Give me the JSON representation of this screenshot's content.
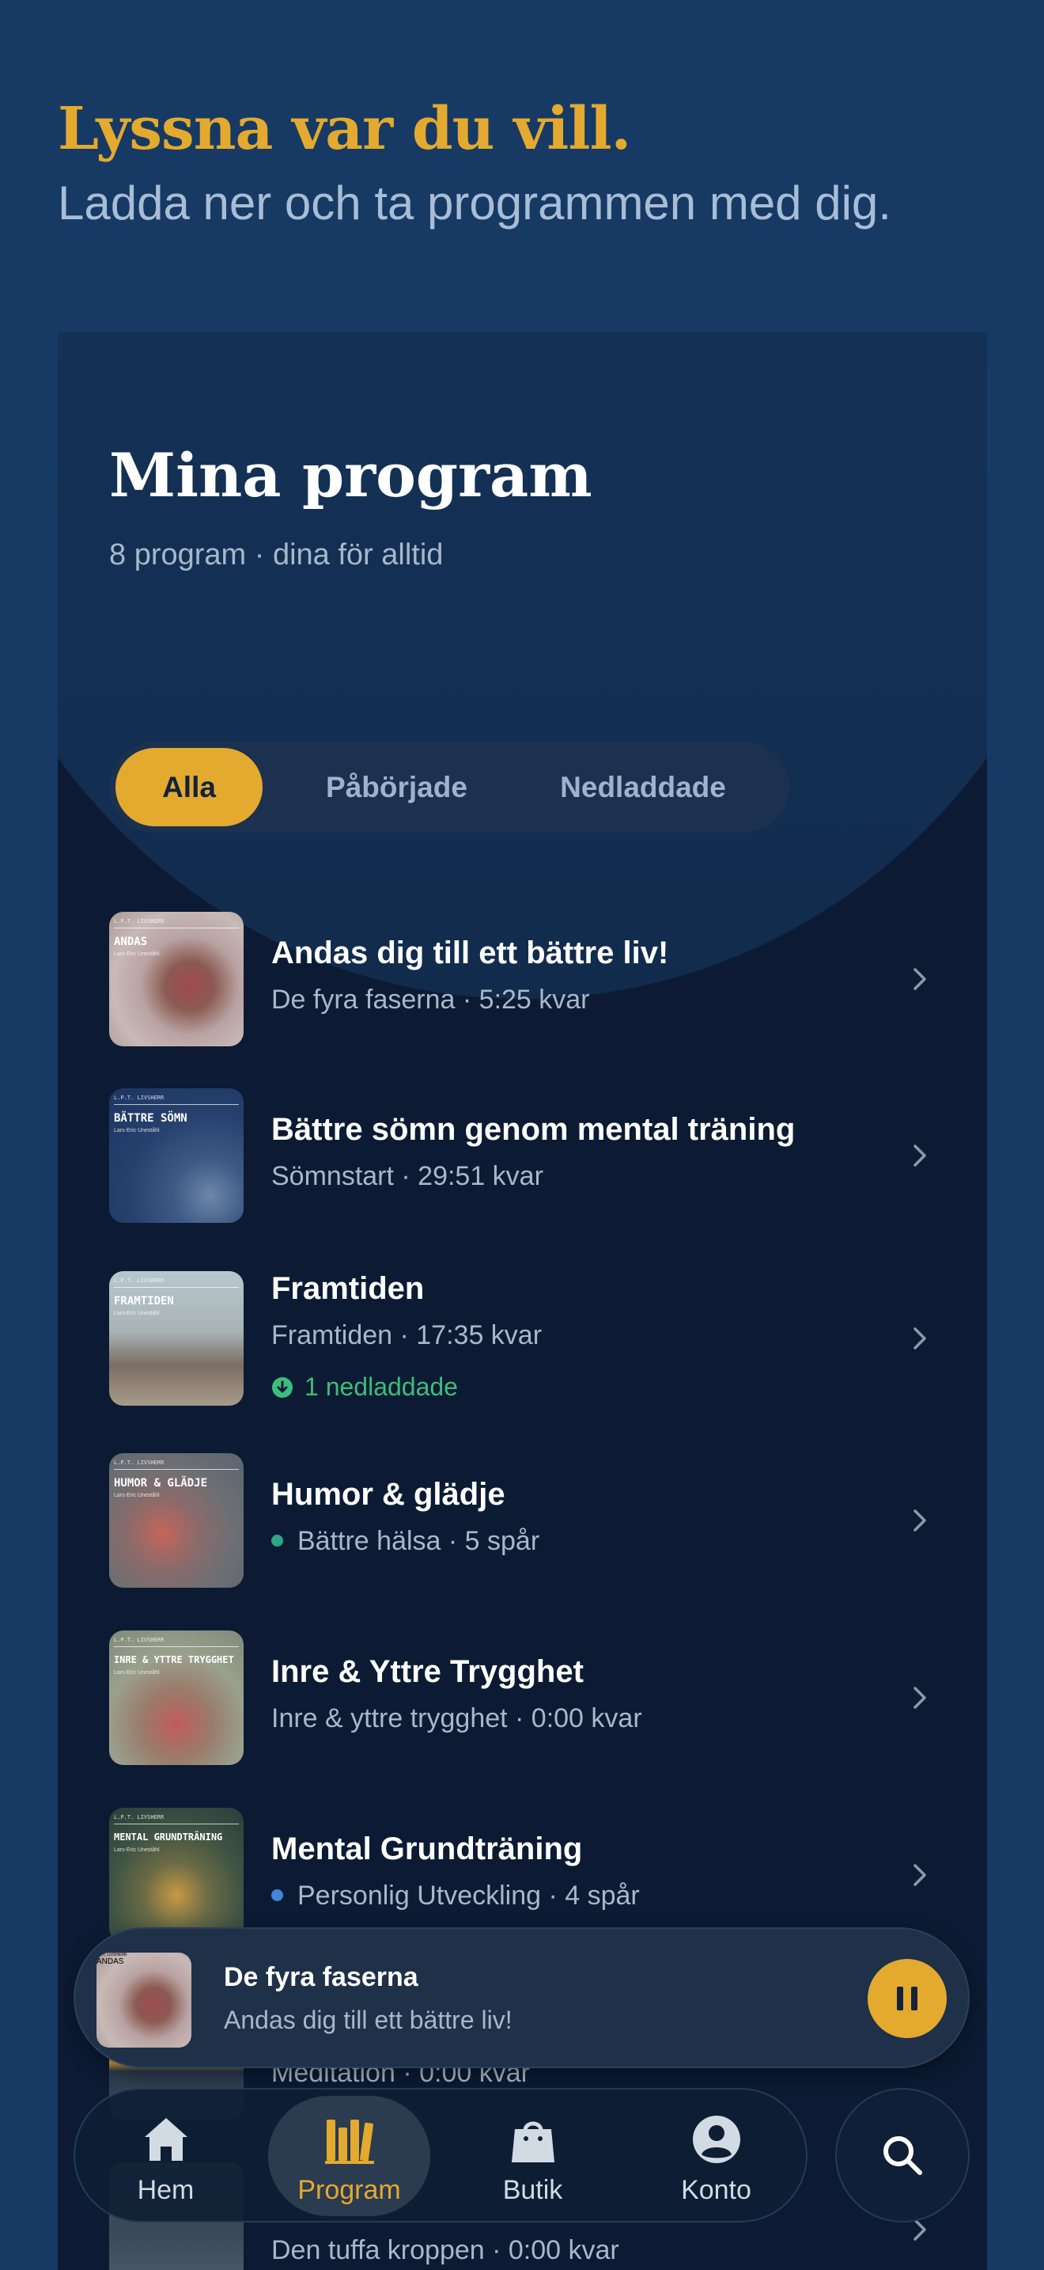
{
  "hero": {
    "title": "Lyssna var du vill.",
    "subtitle": "Ladda ner och ta programmen med dig."
  },
  "library": {
    "title": "Mina program",
    "subtitle": "8 program · dina för alltid",
    "filters": [
      {
        "label": "Alla",
        "active": true
      },
      {
        "label": "Påbörjade",
        "active": false
      },
      {
        "label": "Nedladdade",
        "active": false
      }
    ],
    "items": [
      {
        "title": "Andas dig till ett bättre liv!",
        "subtitle": "De fyra faserna · 5:25 kvar",
        "thumb_label": "ANDAS",
        "icon": "chevron-right-icon"
      },
      {
        "title": "Bättre sömn genom mental träning",
        "subtitle": "Sömnstart · 29:51 kvar",
        "thumb_label": "BÄTTRE SÖMN",
        "icon": "chevron-right-icon"
      },
      {
        "title": "Framtiden",
        "subtitle": "Framtiden · 17:35 kvar",
        "downloaded": "1 nedladdade",
        "thumb_label": "FRAMTIDEN",
        "icon": "chevron-right-icon"
      },
      {
        "title": "Humor & glädje",
        "subtitle": "Bättre hälsa · 5 spår",
        "dot_color": "#2fa58a",
        "thumb_label": "HUMOR & GLÄDJE",
        "icon": "chevron-right-icon"
      },
      {
        "title": "Inre & Yttre Trygghet",
        "subtitle": "Inre & yttre trygghet · 0:00 kvar",
        "thumb_label": "INRE & YTTRE TRYGGHET",
        "icon": "chevron-right-icon"
      },
      {
        "title": "Mental Grundträning",
        "subtitle": "Personlig Utveckling · 4 spår",
        "dot_color": "#3e86d6",
        "thumb_label": "MENTAL GRUNDTRÄNING",
        "icon": "chevron-right-icon"
      },
      {
        "title": "",
        "subtitle": "Meditation · 0:00 kvar",
        "thumb_label": "",
        "icon": "chevron-right-icon"
      },
      {
        "title": "",
        "subtitle": "Den tuffa kroppen · 0:00 kvar",
        "thumb_label": "",
        "icon": "chevron-right-icon"
      }
    ]
  },
  "thumb_publisher": "L.P.T. LIVSHERR",
  "thumb_author": "Lars-Eric Uneståhl",
  "player": {
    "title": "De fyra faserna",
    "subtitle": "Andas dig till ett bättre liv!",
    "thumb_label": "ANDAS",
    "button_icon": "pause-icon"
  },
  "nav": {
    "items": [
      {
        "label": "Hem",
        "icon": "home-icon",
        "active": false
      },
      {
        "label": "Program",
        "icon": "library-icon",
        "active": true
      },
      {
        "label": "Butik",
        "icon": "shopping-bag-icon",
        "active": false
      },
      {
        "label": "Konto",
        "icon": "account-icon",
        "active": false
      }
    ],
    "search_icon": "search-icon"
  },
  "colors": {
    "background": "#173a64",
    "accent": "#e3aa2f",
    "card": "#0c1b33",
    "downloaded": "#3dbd7d"
  }
}
